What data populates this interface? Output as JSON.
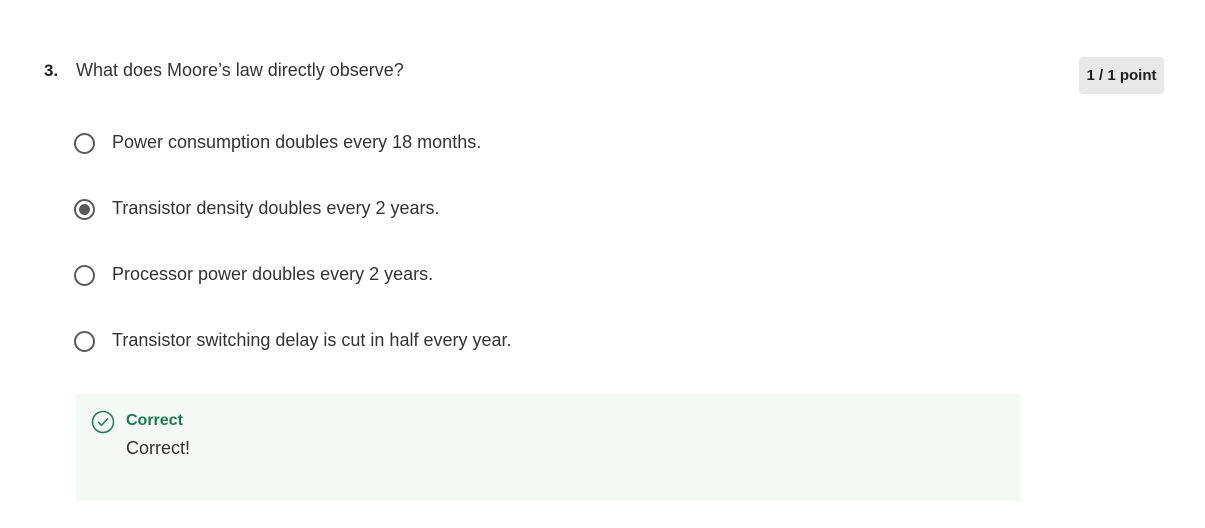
{
  "question": {
    "number": "3.",
    "text": "What does Moore’s law directly observe?",
    "points": "1 / 1 point"
  },
  "options": [
    {
      "label": "Power consumption doubles every 18 months.",
      "selected": false
    },
    {
      "label": "Transistor density doubles every 2 years.",
      "selected": true
    },
    {
      "label": "Processor power doubles every 2 years.",
      "selected": false
    },
    {
      "label": "Transistor switching delay is cut in half every year.",
      "selected": false
    }
  ],
  "feedback": {
    "icon": "check-circle-icon",
    "title": "Correct",
    "message": "Correct!",
    "accent_color": "#1d7a4f",
    "background_color": "#f4f9f6"
  }
}
